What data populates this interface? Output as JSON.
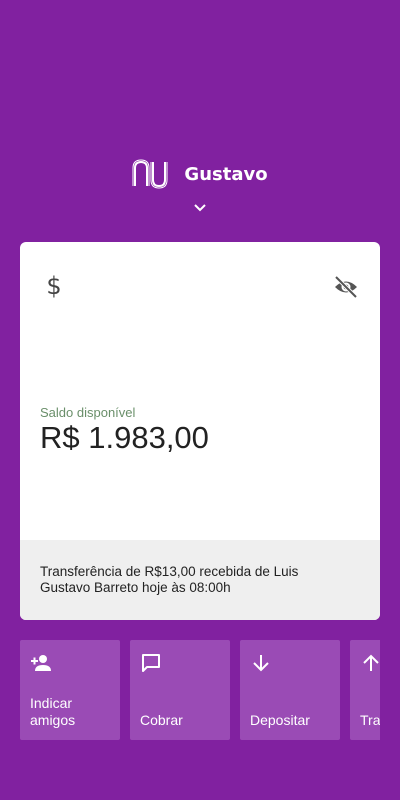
{
  "header": {
    "user_name": "Gustavo",
    "logo_icon": "nubank-logo",
    "toggle_icon": "chevron-down-icon"
  },
  "account_card": {
    "currency_icon": "dollar-icon",
    "visibility_icon": "eye-off-icon",
    "balance_label": "Saldo disponível",
    "balance_value": "R$ 1.983,00",
    "recent_activity": "Transferência de R$13,00 recebida de Luis Gustavo Barreto hoje às 08:00h"
  },
  "actions": [
    {
      "label": "Indicar\namigos",
      "icon": "person-add-icon"
    },
    {
      "label": "Cobrar",
      "icon": "chat-icon"
    },
    {
      "label": "Depositar",
      "icon": "arrow-down-icon"
    },
    {
      "label": "Transferir",
      "icon": "arrow-up-icon"
    }
  ],
  "colors": {
    "background": "#8121a0",
    "action_tile": "#9a4bb5",
    "card": "#ffffff",
    "card_footer": "#efefef"
  }
}
